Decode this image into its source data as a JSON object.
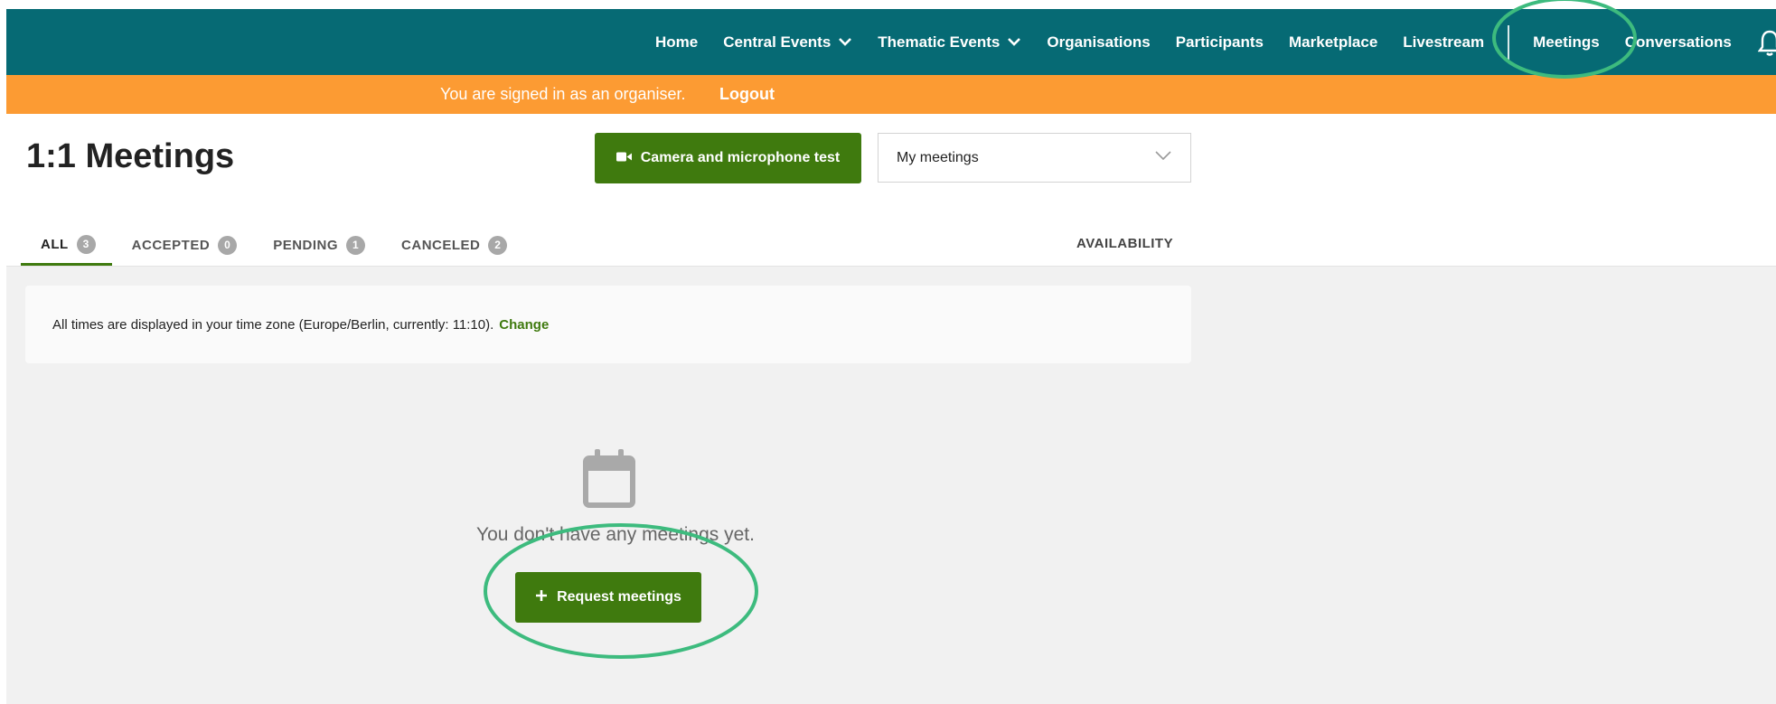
{
  "nav": {
    "items": [
      {
        "label": "Home",
        "has_dropdown": false
      },
      {
        "label": "Central Events",
        "has_dropdown": true
      },
      {
        "label": "Thematic Events",
        "has_dropdown": true
      },
      {
        "label": "Organisations",
        "has_dropdown": false
      },
      {
        "label": "Participants",
        "has_dropdown": false
      },
      {
        "label": "Marketplace",
        "has_dropdown": false
      },
      {
        "label": "Livestream",
        "has_dropdown": false
      },
      {
        "label": "Meetings",
        "has_dropdown": false
      },
      {
        "label": "Conversations",
        "has_dropdown": false
      }
    ],
    "bell_icon": "bell-icon",
    "background": "#066a74"
  },
  "banner": {
    "text": "You are signed in as an organiser.",
    "link": "Logout",
    "background": "#fc9b33"
  },
  "header": {
    "title": "1:1 Meetings",
    "camera_button": "Camera and microphone test",
    "camera_icon": "video-camera-icon",
    "select_value": "My meetings"
  },
  "tabs": [
    {
      "label": "ALL",
      "count": "3",
      "active": true
    },
    {
      "label": "ACCEPTED",
      "count": "0",
      "active": false
    },
    {
      "label": "PENDING",
      "count": "1",
      "active": false
    },
    {
      "label": "CANCELED",
      "count": "2",
      "active": false
    }
  ],
  "availability_label": "AVAILABILITY",
  "timezone": {
    "text": "All times are displayed in your time zone (Europe/Berlin, currently: 11:10).",
    "link": "Change"
  },
  "empty_state": {
    "icon": "calendar-icon",
    "text": "You don't have any meetings yet.",
    "button": "Request meetings",
    "button_icon": "plus-icon"
  },
  "colors": {
    "accent_green": "#3f7a0e",
    "annotation_circle": "#3dbb7e"
  }
}
